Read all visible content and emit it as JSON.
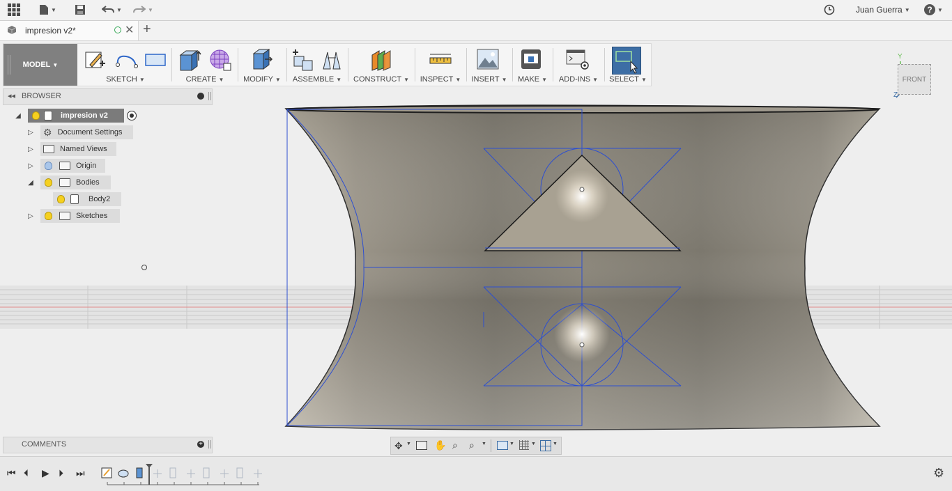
{
  "app": {
    "user_name": "Juan Guerra",
    "accent_color": "#3d6ea5",
    "brand_color": "#808080"
  },
  "topbar": {
    "icons": [
      "grid-icon",
      "file-icon",
      "save-icon",
      "undo-icon",
      "redo-icon",
      "clock-icon",
      "help-icon"
    ],
    "help_label": "?"
  },
  "tab": {
    "title": "impresion v2*",
    "add_label": "+"
  },
  "toolbar": {
    "workspace": "MODEL",
    "groups": {
      "sketch": "SKETCH",
      "create": "CREATE",
      "modify": "MODIFY",
      "assemble": "ASSEMBLE",
      "construct": "CONSTRUCT",
      "inspect": "INSPECT",
      "insert": "INSERT",
      "make": "MAKE",
      "addins": "ADD-INS",
      "select": "SELECT"
    }
  },
  "browser": {
    "title": "BROWSER",
    "root": "impresion v2",
    "items": [
      {
        "label": "Document Settings"
      },
      {
        "label": "Named Views"
      },
      {
        "label": "Origin"
      },
      {
        "label": "Bodies"
      },
      {
        "label": "Body2"
      },
      {
        "label": "Sketches"
      }
    ]
  },
  "comments": {
    "title": "COMMENTS"
  },
  "viewcube": {
    "face": "FRONT",
    "axis_y": "Y",
    "axis_z": "Z"
  },
  "timeline": {
    "buttons": [
      "first-icon",
      "prev-icon",
      "play-icon",
      "next-icon",
      "last-icon"
    ]
  }
}
